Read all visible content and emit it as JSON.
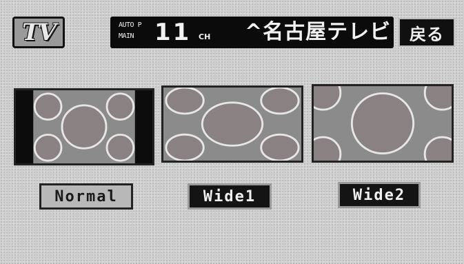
{
  "header": {
    "logo_text": "TV",
    "status": {
      "mode_top": "AUTO P",
      "mode_bottom": "MAIN",
      "channel": "11",
      "channel_unit": "CH",
      "station": "^名古屋テレビ"
    },
    "back_label": "戻る"
  },
  "aspect_modes": [
    {
      "label": "Normal",
      "state": "selected"
    },
    {
      "label": "Wide1",
      "state": "unselected"
    },
    {
      "label": "Wide2",
      "state": "unselected"
    }
  ],
  "colors": {
    "background": "#cfcfcf",
    "bar": "#0b0b0b",
    "circle_fill": "#8a8282",
    "circle_stroke": "#e6e6e6"
  }
}
